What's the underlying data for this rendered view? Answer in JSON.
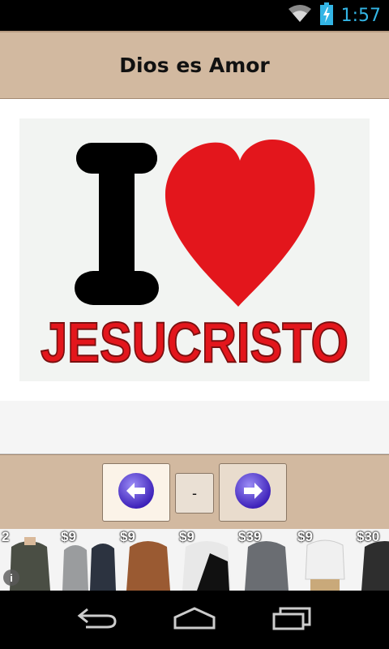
{
  "status_bar": {
    "time": "1:57",
    "icons": [
      "wifi-icon",
      "battery-charging-icon"
    ],
    "accent_color": "#33b5e5"
  },
  "header": {
    "title": "Dios es Amor",
    "background": "#d2b9a0"
  },
  "main_image": {
    "letter": "I",
    "word": "JESUCRISTO",
    "icon": "heart-icon",
    "heart_color": "#e3161c"
  },
  "navigation": {
    "prev_icon": "arrow-left-icon",
    "page_indicator": "-",
    "next_icon": "arrow-right-icon"
  },
  "ad_banner": {
    "items": [
      {
        "price": "2",
        "color": "#4a4e44"
      },
      {
        "price": "$9",
        "color": "#9a9c9e"
      },
      {
        "price": "$9",
        "color": "#9a5a32"
      },
      {
        "price": "$9",
        "color": "#e8e8e8"
      },
      {
        "price": "$39",
        "color": "#6a6d72"
      },
      {
        "price": "$9",
        "color": "#f0f0f0"
      },
      {
        "price": "$30",
        "color": "#2e2e2e"
      }
    ],
    "info_icon": "info-icon"
  },
  "system_nav": {
    "buttons": [
      "back-icon",
      "home-icon",
      "recents-icon"
    ]
  }
}
